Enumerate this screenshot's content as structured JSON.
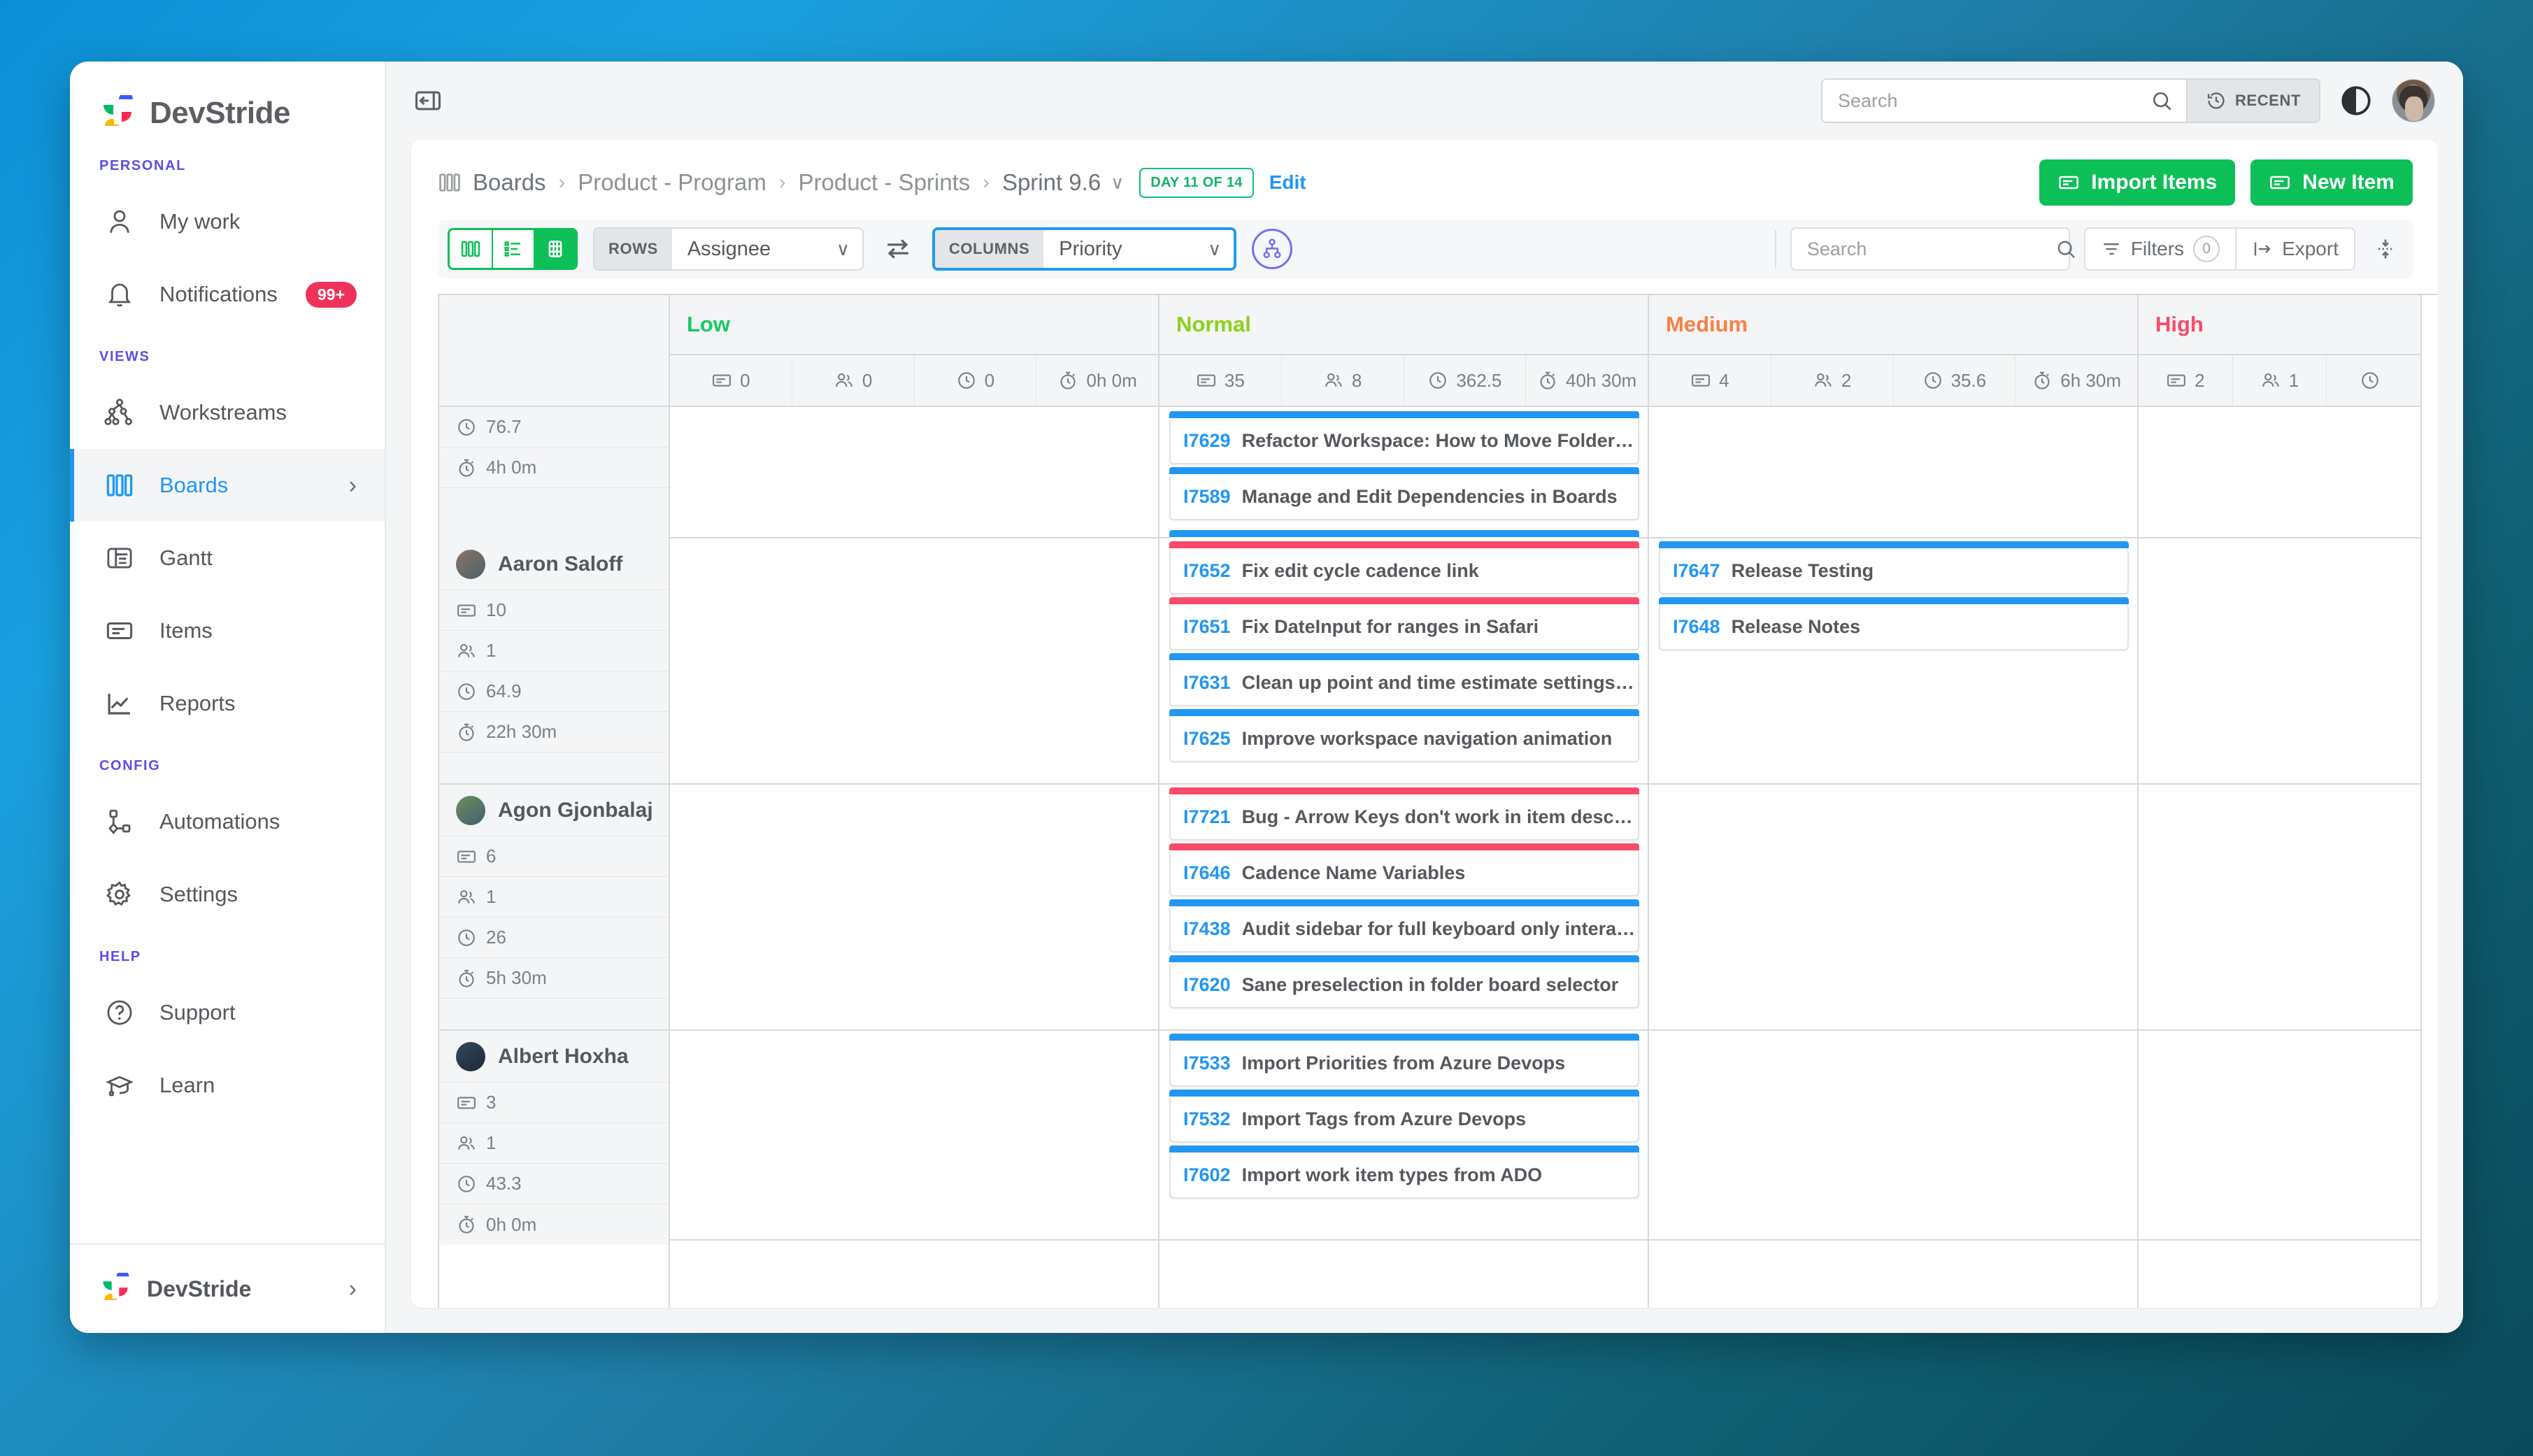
{
  "brand": {
    "name": "DevStride"
  },
  "sidebar": {
    "sections": [
      {
        "label": "PERSONAL"
      },
      {
        "label": "VIEWS"
      },
      {
        "label": "CONFIG"
      },
      {
        "label": "HELP"
      }
    ],
    "personal": [
      {
        "label": "My work",
        "icon": "person-icon"
      },
      {
        "label": "Notifications",
        "icon": "bell-icon",
        "badge": "99+"
      }
    ],
    "views": [
      {
        "label": "Workstreams",
        "icon": "workstream-icon"
      },
      {
        "label": "Boards",
        "icon": "boards-icon",
        "active": true,
        "chevron": "›"
      },
      {
        "label": "Gantt",
        "icon": "gantt-icon"
      },
      {
        "label": "Items",
        "icon": "item-icon"
      },
      {
        "label": "Reports",
        "icon": "chart-icon"
      }
    ],
    "config": [
      {
        "label": "Automations",
        "icon": "automation-icon"
      },
      {
        "label": "Settings",
        "icon": "gear-icon"
      }
    ],
    "help": [
      {
        "label": "Support",
        "icon": "question-circle-icon"
      },
      {
        "label": "Learn",
        "icon": "graduation-cap-icon"
      }
    ],
    "footer": {
      "workspace": "DevStride",
      "chevron": "›"
    }
  },
  "topbar": {
    "collapse_icon": "collapse-sidebar-icon",
    "search": {
      "placeholder": "Search",
      "value": ""
    },
    "recent_label": "RECENT",
    "theme_toggle_icon": "contrast-icon",
    "avatar": "user-avatar"
  },
  "breadcrumb": {
    "items": [
      {
        "label": "Boards",
        "icon": "boards-icon"
      },
      {
        "label": "Product - Program"
      },
      {
        "label": "Product - Sprints"
      },
      {
        "label": "Sprint 9.6",
        "caret": "∨"
      }
    ],
    "separator": "›",
    "day_chip": "DAY 11 OF 14",
    "edit_label": "Edit"
  },
  "actions": {
    "import_label": "Import Items",
    "new_item_label": "New Item"
  },
  "toolbar": {
    "views": [
      {
        "name": "kanban-view",
        "active": false
      },
      {
        "name": "list-view",
        "active": false
      },
      {
        "name": "grid-view",
        "active": true
      }
    ],
    "rows": {
      "label": "ROWS",
      "value": "Assignee",
      "caret": "∨"
    },
    "swap_icon": "swap-axes-icon",
    "columns": {
      "label": "COLUMNS",
      "value": "Priority",
      "caret": "∨"
    },
    "hierarchy_icon": "hierarchy-icon",
    "search": {
      "placeholder": "Search",
      "value": ""
    },
    "filters": {
      "label": "Filters",
      "count": "0"
    },
    "export": {
      "label": "Export"
    },
    "expand_icon": "expand-rows-icon"
  },
  "board": {
    "columns": [
      {
        "title": "Low",
        "color": "#18c964",
        "stats": [
          {
            "icon": "item-icon",
            "value": "0"
          },
          {
            "icon": "people-icon",
            "value": "0"
          },
          {
            "icon": "clock-icon",
            "value": "0"
          },
          {
            "icon": "stopwatch-icon",
            "value": "0h 0m"
          }
        ]
      },
      {
        "title": "Normal",
        "color": "#8bd11c",
        "stats": [
          {
            "icon": "item-icon",
            "value": "35"
          },
          {
            "icon": "people-icon",
            "value": "8"
          },
          {
            "icon": "clock-icon",
            "value": "362.5"
          },
          {
            "icon": "stopwatch-icon",
            "value": "40h 30m"
          }
        ]
      },
      {
        "title": "Medium",
        "color": "#f98044",
        "stats": [
          {
            "icon": "item-icon",
            "value": "4"
          },
          {
            "icon": "people-icon",
            "value": "2"
          },
          {
            "icon": "clock-icon",
            "value": "35.6"
          },
          {
            "icon": "stopwatch-icon",
            "value": "6h 30m"
          }
        ]
      },
      {
        "title": "High",
        "color": "#fb4a68",
        "stats": [
          {
            "icon": "item-icon",
            "value": "2"
          },
          {
            "icon": "people-icon",
            "value": "1"
          },
          {
            "icon": "clock-icon",
            "value": ""
          }
        ]
      }
    ],
    "groups": [
      {
        "name": "",
        "partial": true,
        "stats": [
          {
            "icon": "clock-icon",
            "value": "76.7"
          },
          {
            "icon": "stopwatch-icon",
            "value": "4h 0m"
          }
        ],
        "cells": {
          "Low": [],
          "Normal": [
            {
              "id": "I7629",
              "title": "Refactor Workspace: How to Move Folders f…",
              "bar": "#2196f3"
            },
            {
              "id": "I7589",
              "title": "Manage and Edit Dependencies in Boards",
              "bar": "#2196f3"
            }
          ],
          "Medium": [],
          "High": []
        }
      },
      {
        "name": "Aaron Saloff",
        "avatar_colors": [
          "#7d6a5b",
          "#4a5d66"
        ],
        "stats": [
          {
            "icon": "item-icon",
            "value": "10"
          },
          {
            "icon": "people-icon",
            "value": "1"
          },
          {
            "icon": "clock-icon",
            "value": "64.9"
          },
          {
            "icon": "stopwatch-icon",
            "value": "22h 30m"
          }
        ],
        "cells": {
          "Low": [],
          "Normal": [
            {
              "id": "I7652",
              "title": "Fix edit cycle cadence link",
              "bar": "#fb4a68"
            },
            {
              "id": "I7651",
              "title": "Fix DateInput for ranges in Safari",
              "bar": "#fb4a68"
            },
            {
              "id": "I7631",
              "title": "Clean up point and time estimate settings t…",
              "bar": "#2196f3"
            },
            {
              "id": "I7625",
              "title": "Improve workspace navigation animation",
              "bar": "#2196f3"
            }
          ],
          "Medium": [
            {
              "id": "I7647",
              "title": "Release Testing",
              "bar": "#2196f3"
            },
            {
              "id": "I7648",
              "title": "Release Notes",
              "bar": "#2196f3"
            }
          ],
          "High": []
        }
      },
      {
        "name": "Agon Gjonbalaj",
        "avatar_colors": [
          "#5a7a4a",
          "#3d5a70"
        ],
        "stats": [
          {
            "icon": "item-icon",
            "value": "6"
          },
          {
            "icon": "people-icon",
            "value": "1"
          },
          {
            "icon": "clock-icon",
            "value": "26"
          },
          {
            "icon": "stopwatch-icon",
            "value": "5h 30m"
          }
        ],
        "cells": {
          "Low": [],
          "Normal": [
            {
              "id": "I7721",
              "title": "Bug - Arrow Keys don't work in item descrip…",
              "bar": "#fb4a68"
            },
            {
              "id": "I7646",
              "title": "Cadence Name Variables",
              "bar": "#fb4a68"
            },
            {
              "id": "I7438",
              "title": "Audit sidebar for full keyboard only interact…",
              "bar": "#2196f3"
            },
            {
              "id": "I7620",
              "title": "Sane preselection in folder board selector",
              "bar": "#2196f3"
            }
          ],
          "Medium": [],
          "High": []
        }
      },
      {
        "name": "Albert Hoxha",
        "avatar_colors": [
          "#2b3d52",
          "#1f2d3d"
        ],
        "stats": [
          {
            "icon": "item-icon",
            "value": "3"
          },
          {
            "icon": "people-icon",
            "value": "1"
          },
          {
            "icon": "clock-icon",
            "value": "43.3"
          },
          {
            "icon": "stopwatch-icon",
            "value": "0h 0m"
          }
        ],
        "cells": {
          "Low": [],
          "Normal": [
            {
              "id": "I7533",
              "title": "Import Priorities from Azure Devops",
              "bar": "#2196f3"
            },
            {
              "id": "I7532",
              "title": "Import Tags from Azure Devops",
              "bar": "#2196f3"
            },
            {
              "id": "I7602",
              "title": "Import work item types from ADO",
              "bar": "#2196f3"
            }
          ],
          "Medium": [],
          "High": []
        }
      }
    ]
  },
  "colors": {
    "accent_blue": "#2196f3",
    "green": "#0dbf57",
    "purple": "#5c4ee5",
    "red": "#f0325a"
  }
}
